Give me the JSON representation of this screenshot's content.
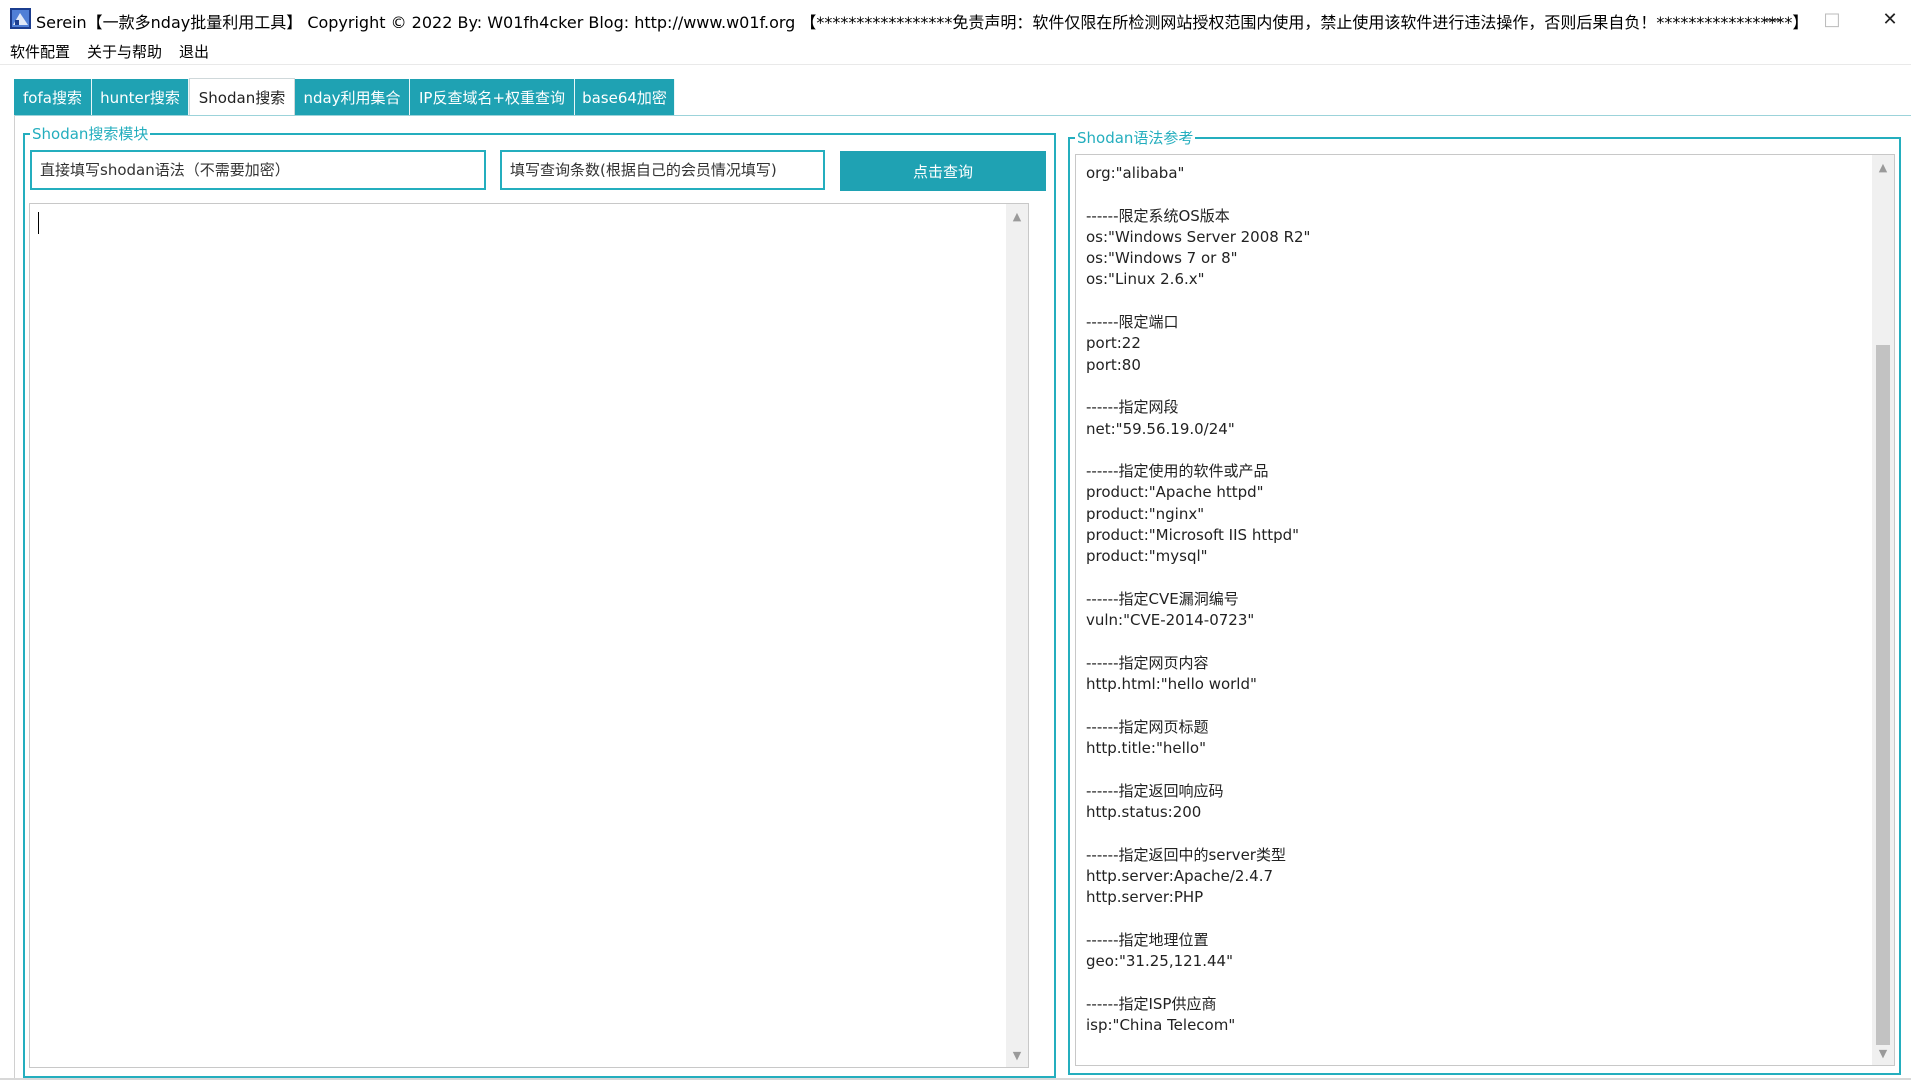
{
  "window": {
    "title": "Serein【一款多nday批量利用工具】   Copyright © 2022    By: W01fh4cker    Blog: http://www.w01f.org      【*****************免责声明：软件仅限在所检测网站授权范围内使用，禁止使用该软件进行违法操作，否则后果自负！*****************】",
    "minimize_icon": "minimize-icon",
    "maximize_icon": "maximize-icon",
    "close_icon": "close-icon"
  },
  "menu": {
    "items": [
      {
        "label": "软件配置"
      },
      {
        "label": "关于与帮助"
      },
      {
        "label": "退出"
      }
    ]
  },
  "tabs": [
    {
      "label": "fofa搜索",
      "active": false
    },
    {
      "label": "hunter搜索",
      "active": false
    },
    {
      "label": "Shodan搜索",
      "active": true
    },
    {
      "label": "nday利用集合",
      "active": false
    },
    {
      "label": "IP反查域名+权重查询",
      "active": false
    },
    {
      "label": "base64加密",
      "active": false
    }
  ],
  "search_module": {
    "group_title": "Shodan搜索模块",
    "query_placeholder": "直接填写shodan语法（不需要加密）",
    "count_placeholder": "填写查询条数(根据自己的会员情况填写)",
    "query_button": "点击查询",
    "results_text": ""
  },
  "reference": {
    "group_title": "Shodan语法参考",
    "text": "org:\"alibaba\"\n\n------限定系统OS版本\nos:\"Windows Server 2008 R2\"\nos:\"Windows 7 or 8\"\nos:\"Linux 2.6.x\"\n\n------限定端口\nport:22\nport:80\n\n------指定网段\nnet:\"59.56.19.0/24\"\n\n------指定使用的软件或产品\nproduct:\"Apache httpd\"\nproduct:\"nginx\"\nproduct:\"Microsoft IIS httpd\"\nproduct:\"mysql\"\n\n------指定CVE漏洞编号\nvuln:\"CVE-2014-0723\"\n\n------指定网页内容\nhttp.html:\"hello world\"\n\n------指定网页标题\nhttp.title:\"hello\"\n\n------指定返回响应码\nhttp.status:200\n\n------指定返回中的server类型\nhttp.server:Apache/2.4.7\nhttp.server:PHP\n\n------指定地理位置\ngeo:\"31.25,121.44\"\n\n------指定ISP供应商\nisp:\"China Telecom\""
  },
  "colors": {
    "accent": "#1fa2b3",
    "border": "#24aebe",
    "scroll_track": "#f0f0f0",
    "scroll_thumb": "#c2c2c2"
  }
}
